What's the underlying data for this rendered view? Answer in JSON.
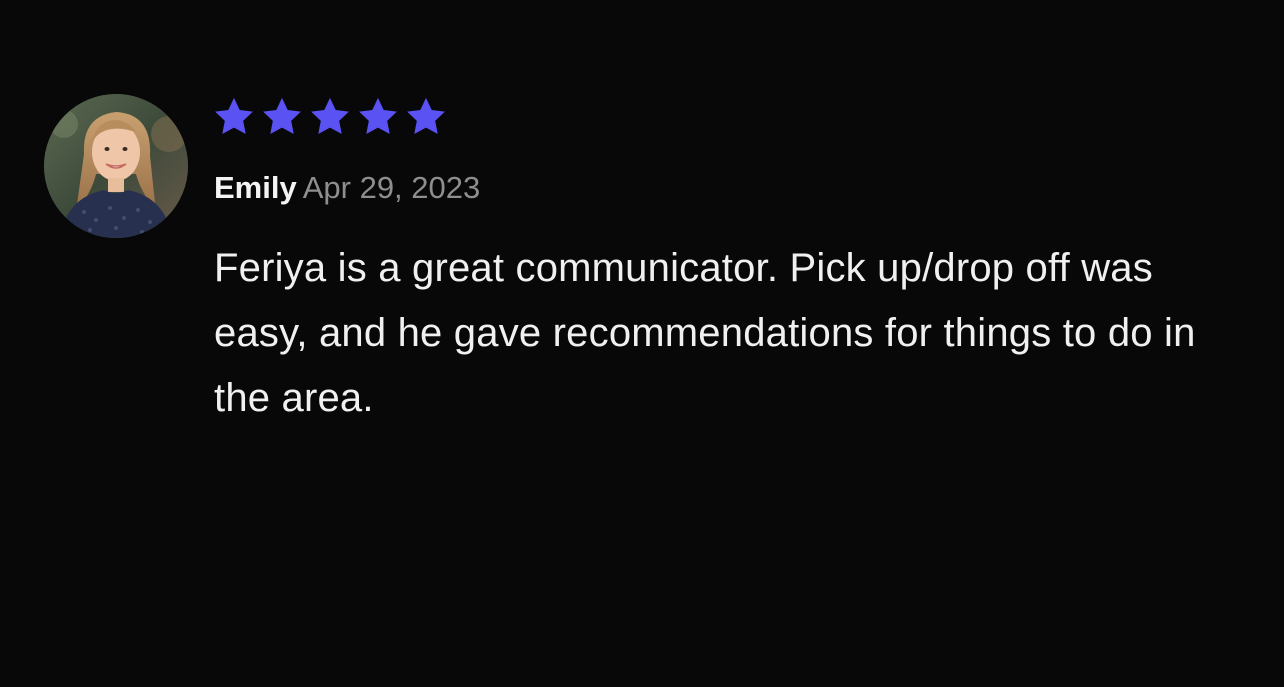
{
  "review": {
    "rating": 5,
    "rating_max": 5,
    "star_color": "#5b52f4",
    "author": "Emily",
    "date": "Apr 29, 2023",
    "text": "Feriya is a great communicator. Pick up/drop off was easy, and he gave recommendations for things to do in the area."
  },
  "colors": {
    "background": "#080808",
    "text": "#f0f0f0",
    "muted": "#8e8e8e"
  }
}
